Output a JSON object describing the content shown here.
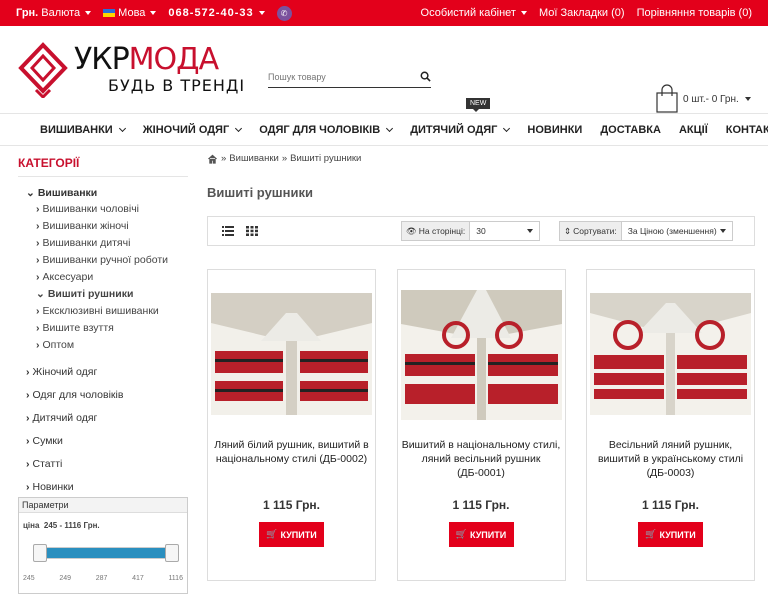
{
  "topbar": {
    "currency": "Грн.",
    "currency_menu": "Валюта",
    "language": "Мова",
    "phone": "068-572-40-33",
    "account": "Особистий кабінет",
    "wishlist": "Мої Закладки (0)",
    "compare": "Порівняння товарів (0)"
  },
  "header": {
    "logo_main": "УКР",
    "logo_accent": "МОДА",
    "logo_tagline": "БУДЬ В ТРЕНДІ",
    "search_placeholder": "Пошук товару",
    "cart_text": "0 шт.- 0 Грн."
  },
  "nav": {
    "items": [
      {
        "label": "ВИШИВАНКИ",
        "dropdown": true
      },
      {
        "label": "ЖІНОЧИЙ ОДЯГ",
        "dropdown": true
      },
      {
        "label": "ОДЯГ ДЛЯ ЧОЛОВІКІВ",
        "dropdown": true
      },
      {
        "label": "ДИТЯЧИЙ ОДЯГ",
        "dropdown": true
      },
      {
        "label": "НОВИНКИ",
        "dropdown": false
      },
      {
        "label": "ДОСТАВКА",
        "dropdown": false
      },
      {
        "label": "АКЦІЇ",
        "dropdown": false
      },
      {
        "label": "КОНТАКТИ",
        "dropdown": false
      }
    ],
    "new_badge": "NEW"
  },
  "sidebar": {
    "title": "КАТЕГОРІЇ",
    "open_category": "Вишиванки",
    "subcategories": [
      "Вишиванки чоловічі",
      "Вишиванки жіночі",
      "Вишиванки дитячі",
      "Вишиванки ручної роботи",
      "Аксесуари",
      "Вишиті рушники",
      "Ексклюзивні вишиванки",
      "Вишите взуття",
      "Оптом"
    ],
    "categories": [
      "Жіночий одяг",
      "Одяг для чоловіків",
      "Дитячий одяг",
      "Сумки",
      "Статті",
      "Новинки"
    ],
    "params_title": "Параметри",
    "price_label": "ціна",
    "price_range": "245 - 1116 Грн.",
    "range_low": 0.0,
    "range_high": 1.0,
    "ticks": [
      "245",
      "249",
      "287",
      "417",
      "1116"
    ]
  },
  "main": {
    "breadcrumb": [
      "Вишиванки",
      "Вишиті рушники"
    ],
    "page_title": "Вишиті рушники",
    "per_page_label": "На сторінці:",
    "per_page_value": "30",
    "sort_label": "Сортувати:",
    "sort_value": "За Ціною (зменшення)"
  },
  "products": [
    {
      "name": "Ляний білий рушник, вишитий в національному стилі (ДБ-0002)",
      "price": "1 115 Грн.",
      "buy": "КУПИТИ"
    },
    {
      "name": "Вишитий в національному стилі, ляний весільний рушник (ДБ-0001)",
      "price": "1 115 Грн.",
      "buy": "КУПИТИ"
    },
    {
      "name": "Весільний ляний рушник, вишитий в українському стилі (ДБ-0003)",
      "price": "1 115 Грн.",
      "buy": "КУПИТИ"
    }
  ],
  "colors": {
    "brand_red": "#e3001b",
    "logo_red": "#c8102e",
    "slider_blue": "#2a8fbf"
  }
}
